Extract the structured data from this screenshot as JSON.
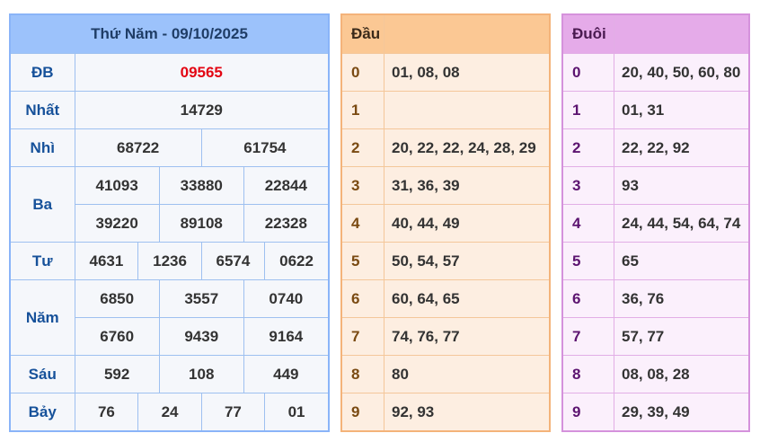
{
  "results": {
    "title": "Thứ Năm - 09/10/2025",
    "special_label": "ĐB",
    "special": "09565",
    "first_label": "Nhất",
    "first": "14729",
    "second_label": "Nhì",
    "second": [
      "68722",
      "61754"
    ],
    "third_label": "Ba",
    "third": [
      "41093",
      "33880",
      "22844",
      "39220",
      "89108",
      "22328"
    ],
    "fourth_label": "Tư",
    "fourth": [
      "4631",
      "1236",
      "6574",
      "0622"
    ],
    "fifth_label": "Năm",
    "fifth": [
      "6850",
      "3557",
      "0740",
      "6760",
      "9439",
      "9164"
    ],
    "sixth_label": "Sáu",
    "sixth": [
      "592",
      "108",
      "449"
    ],
    "seventh_label": "Bảy",
    "seventh": [
      "76",
      "24",
      "77",
      "01"
    ]
  },
  "head": {
    "title": "Đầu",
    "rows": [
      {
        "key": "0",
        "values": "01, 08, 08"
      },
      {
        "key": "1",
        "values": ""
      },
      {
        "key": "2",
        "values": "20, 22, 22, 24, 28, 29"
      },
      {
        "key": "3",
        "values": "31, 36, 39"
      },
      {
        "key": "4",
        "values": "40, 44, 49"
      },
      {
        "key": "5",
        "values": "50, 54, 57"
      },
      {
        "key": "6",
        "values": "60, 64, 65"
      },
      {
        "key": "7",
        "values": "74, 76, 77"
      },
      {
        "key": "8",
        "values": "80"
      },
      {
        "key": "9",
        "values": "92, 93"
      }
    ]
  },
  "tail": {
    "title": "Đuôi",
    "rows": [
      {
        "key": "0",
        "values": "20, 40, 50, 60, 80"
      },
      {
        "key": "1",
        "values": "01, 31"
      },
      {
        "key": "2",
        "values": "22, 22, 92"
      },
      {
        "key": "3",
        "values": "93"
      },
      {
        "key": "4",
        "values": "24, 44, 54, 64, 74"
      },
      {
        "key": "5",
        "values": "65"
      },
      {
        "key": "6",
        "values": "36, 76"
      },
      {
        "key": "7",
        "values": "57, 77"
      },
      {
        "key": "8",
        "values": "08, 08, 28"
      },
      {
        "key": "9",
        "values": "29, 39, 49"
      }
    ]
  },
  "colors": {
    "special_number": "#e30613",
    "prize_header": "#9cc2fb",
    "head_header": "#fbc894",
    "tail_header": "#e5abe9"
  }
}
